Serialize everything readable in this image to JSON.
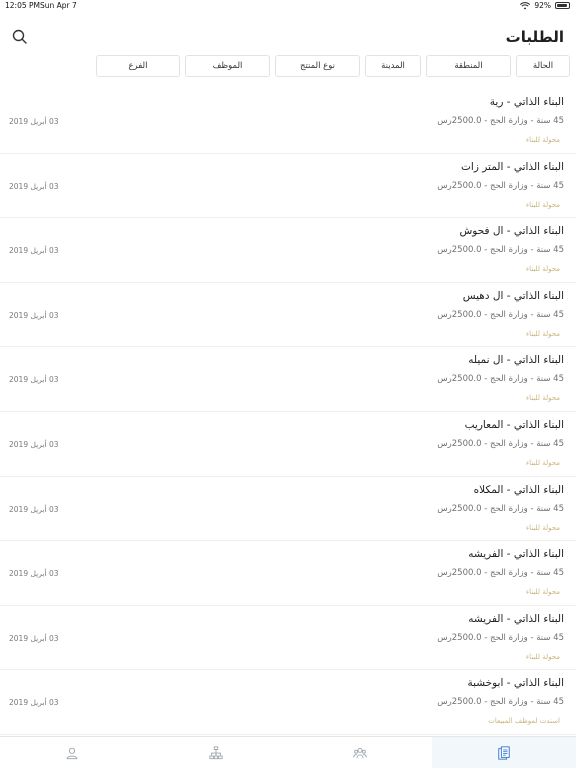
{
  "status_bar": {
    "time": "12:05 PM",
    "date": "Sun Apr 7",
    "battery": "92%",
    "battery_level": 0.92
  },
  "header": {
    "title": "الطلبات"
  },
  "filters": [
    {
      "label": "الحالة"
    },
    {
      "label": "المنطقة"
    },
    {
      "label": "المدينة"
    },
    {
      "label": "نوع المنتج"
    },
    {
      "label": "الموظف"
    },
    {
      "label": "الفرع"
    }
  ],
  "requests": [
    {
      "title": "البناء الذاتي - رية",
      "subtitle": "45 سنة - وزارة الحج - 2500.0رس",
      "status": "محولة للبناء",
      "date": "03 أبريل 2019"
    },
    {
      "title": "البناء الذاتي - المتر زات",
      "subtitle": "45 سنة - وزارة الحج - 2500.0رس",
      "status": "محولة للبناء",
      "date": "03 أبريل 2019"
    },
    {
      "title": "البناء الذاتي - ال فحوش",
      "subtitle": "45 سنة - وزارة الحج - 2500.0رس",
      "status": "محولة للبناء",
      "date": "03 أبريل 2019"
    },
    {
      "title": "البناء الذاتي - ال دهيس",
      "subtitle": "45 سنة - وزارة الحج - 2500.0رس",
      "status": "محولة للبناء",
      "date": "03 أبريل 2019"
    },
    {
      "title": "البناء الذاتي - ال نميله",
      "subtitle": "45 سنة - وزارة الحج - 2500.0رس",
      "status": "محولة للبناء",
      "date": "03 أبريل 2019"
    },
    {
      "title": "البناء الذاتي - المعاريب",
      "subtitle": "45 سنة - وزارة الحج - 2500.0رس",
      "status": "محولة للبناء",
      "date": "03 أبريل 2019"
    },
    {
      "title": "البناء الذاتي - المكلاه",
      "subtitle": "45 سنة - وزارة الحج - 2500.0رس",
      "status": "محولة للبناء",
      "date": "03 أبريل 2019"
    },
    {
      "title": "البناء الذاتي - الفريشه",
      "subtitle": "45 سنة - وزارة الحج - 2500.0رس",
      "status": "محولة للبناء",
      "date": "03 أبريل 2019"
    },
    {
      "title": "البناء الذاتي - الفريشه",
      "subtitle": "45 سنة - وزارة الحج - 2500.0رس",
      "status": "محولة للبناء",
      "date": "03 أبريل 2019"
    },
    {
      "title": "البناء الذاتي - ابوخشبة",
      "subtitle": "45 سنة - وزارة الحج - 2500.0رس",
      "status": "اسندت لموظف المبيعات",
      "date": "03 أبريل 2019"
    }
  ],
  "tabbar": [
    {
      "icon": "user-icon",
      "active": false
    },
    {
      "icon": "org-chart-icon",
      "active": false
    },
    {
      "icon": "group-icon",
      "active": false
    },
    {
      "icon": "documents-icon",
      "active": true
    }
  ],
  "colors": {
    "accent": "#c8b47d",
    "tab_active_bg": "#f2f7fb",
    "tab_icon": "#9aa3ad",
    "tab_icon_active": "#3a7bd5"
  }
}
